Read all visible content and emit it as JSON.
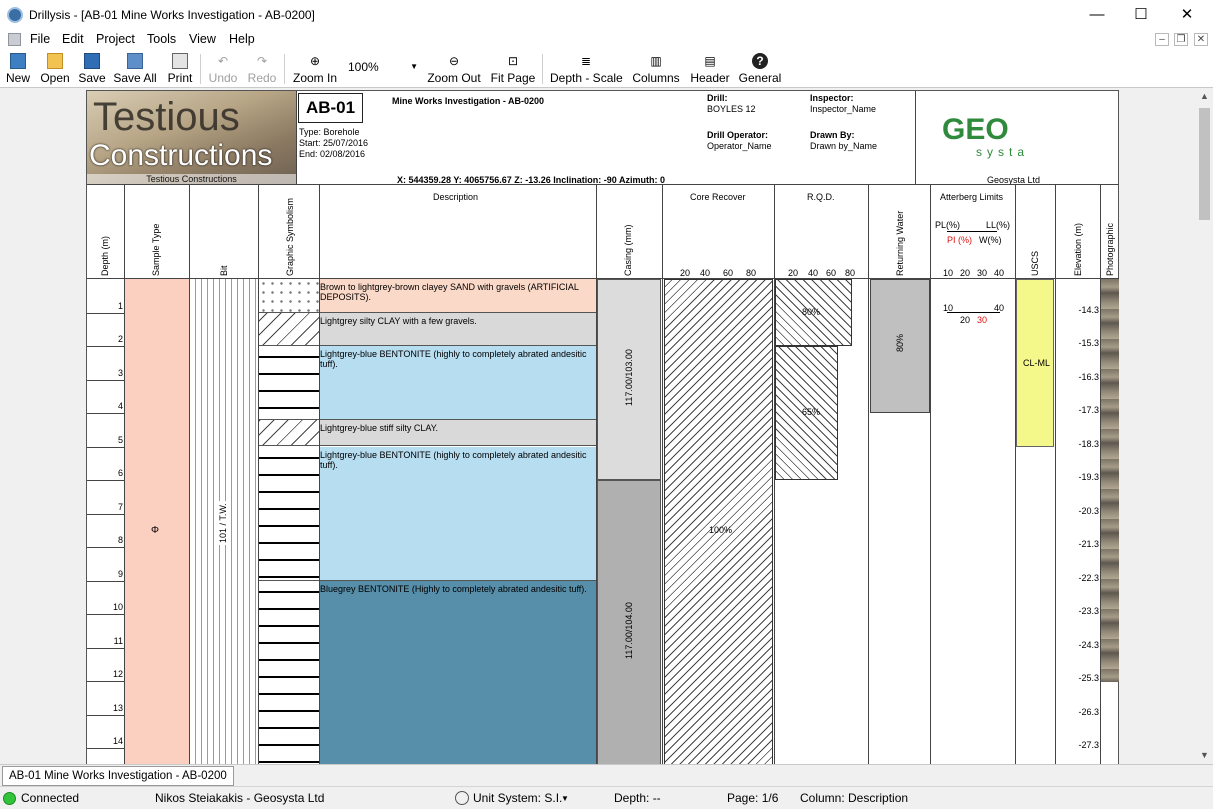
{
  "window": {
    "title": "Drillysis - [AB-01 Mine Works Investigation - AB-0200]",
    "min": "—",
    "max": "☐",
    "close": "✕"
  },
  "menu": [
    "File",
    "Edit",
    "Project",
    "Tools",
    "View",
    "Help"
  ],
  "mdi_controls": [
    "‒",
    "❐",
    "✕"
  ],
  "toolbar": {
    "new": "New",
    "open": "Open",
    "save": "Save",
    "save_all": "Save All",
    "print": "Print",
    "undo": "Undo",
    "redo": "Redo",
    "zoom_in": "Zoom In",
    "zoom_value": "100%",
    "zoom_out": "Zoom Out",
    "fit_page": "Fit Page",
    "depth_scale": "Depth - Scale",
    "columns": "Columns",
    "header": "Header",
    "general": "General"
  },
  "header": {
    "logo_text_1": "Testious",
    "logo_text_2": "Constructions",
    "logo_caption": "Testious Constructions",
    "borehole_id": "AB-01",
    "project": "Mine Works Investigation - AB-0200",
    "type": "Type: Borehole",
    "start": "Start: 25/07/2016",
    "end": "End:  02/08/2016",
    "drill_label": "Drill:",
    "drill": "BOYLES 12",
    "operator_label": "Drill Operator:",
    "operator": "Operator_Name",
    "inspector_label": "Inspector:",
    "inspector": "Inspector_Name",
    "drawn_label": "Drawn By:",
    "drawn": "Drawn by_Name",
    "coords": "X: 544359.28  Y: 4065756.67  Z: -13.26  Inclination: -90  Azimuth:  0",
    "geo_logo": "GEO",
    "geo_logo_2": "systa",
    "geo_caption": "Geosysta Ltd"
  },
  "columns": {
    "depth": "Depth (m)",
    "sample": "Sample Type",
    "bit": "Bit",
    "graphic": "Graphic Symbolism",
    "description": "Description",
    "casing": "Casing (mm)",
    "core": "Core Recover",
    "rqd": "R.Q.D.",
    "returning": "Returning Water",
    "atterberg": "Atterberg Limits",
    "uscs": "USCS",
    "elevation": "Elevation (m)",
    "photo": "Photographic",
    "core_ticks": [
      "20",
      "40",
      "60",
      "80"
    ],
    "rqd_ticks": [
      "20",
      "40",
      "60",
      "80"
    ],
    "att_pl": "PL(%)",
    "att_ll": "LL(%)",
    "att_pi": "PI (%)",
    "att_w": "W(%)",
    "att_ticks": [
      "10",
      "20",
      "30",
      "40"
    ]
  },
  "depths": [
    "1",
    "2",
    "3",
    "4",
    "5",
    "6",
    "7",
    "8",
    "9",
    "10",
    "11",
    "12",
    "13",
    "14"
  ],
  "elevations": [
    "-14.3",
    "-15.3",
    "-16.3",
    "-17.3",
    "-18.3",
    "-19.3",
    "-20.3",
    "-21.3",
    "-22.3",
    "-23.3",
    "-24.3",
    "-25.3",
    "-26.3",
    "-27.3"
  ],
  "layers": [
    {
      "text": "Brown to lightgrey-brown clayey SAND with gravels (ARTIFICIAL DEPOSITS).",
      "color": "#fbd9c8"
    },
    {
      "text": "Lightgrey silty CLAY with a few gravels.",
      "color": "#d9d9d9"
    },
    {
      "text": "Lightgrey-blue BENTONITE (highly to completely abrated andesitic tuff).",
      "color": "#b7ddf1"
    },
    {
      "text": "Lightgrey-blue stiff silty CLAY.",
      "color": "#d9d9d9"
    },
    {
      "text": "Lightgrey-blue BENTONITE (highly to completely abrated andesitic tuff).",
      "color": "#b7ddf1"
    },
    {
      "text": "Bluegrey BENTONITE (Highly to completely abrated andesitic tuff).",
      "color": "#578ea9"
    }
  ],
  "sample_symbol": "Φ",
  "bit_label": "101 / T.W.",
  "casing": [
    "117.00/103.00",
    "117.00/104.00"
  ],
  "core_pct": "100%",
  "rqd": [
    {
      "pct": "80%",
      "value": 80
    },
    {
      "pct": "65%",
      "value": 65
    }
  ],
  "returning_water": "80%",
  "atterberg": {
    "pl": "10",
    "ll": "40",
    "pi": "20",
    "w": "30"
  },
  "uscs_value": "CL-ML",
  "tab": "AB-01 Mine Works Investigation - AB-0200",
  "status": {
    "connected": "Connected",
    "user": "Nikos Steiakakis - Geosysta Ltd",
    "unit": "Unit System: S.I.",
    "depth": "Depth:  --",
    "page": "Page: 1/6",
    "column": "Column: Description"
  }
}
